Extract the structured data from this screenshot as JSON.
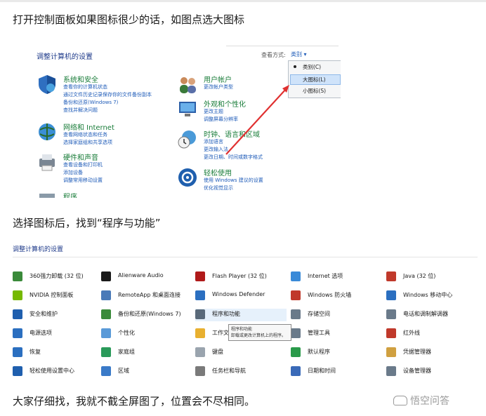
{
  "paragraphs": {
    "p1": "打开控制面板如果图标很少的话，如图点选大图标",
    "p2": "选择图标后，找到“程序与功能”",
    "p3": "大家仔细找，我就不截全屏图了，位置会不尽相同。"
  },
  "shot1": {
    "title": "调整计算机的设置",
    "view_by_label": "查看方式:",
    "view_by_value": "类别 ▾",
    "menu": [
      "类别(C)",
      "大图标(L)",
      "小图标(S)"
    ],
    "categories": [
      {
        "heading": "系统和安全",
        "links": [
          "查看你的计算机状态",
          "通过文件历史记录保存你的文件备份副本",
          "备份和还原(Windows 7)",
          "查找并解决问题"
        ]
      },
      {
        "heading": "网络和 Internet",
        "links": [
          "查看网络状态和任务",
          "选择家庭组和共享选项"
        ]
      },
      {
        "heading": "硬件和声音",
        "links": [
          "查看设备和打印机",
          "添加设备",
          "调整常用移动设置"
        ]
      },
      {
        "heading": "程序",
        "links": []
      },
      {
        "heading": "用户帐户",
        "links": [
          "更改帐户类型"
        ]
      },
      {
        "heading": "外观和个性化",
        "links": [
          "更改主题",
          "调整屏幕分辨率"
        ]
      },
      {
        "heading": "时钟、语言和区域",
        "links": [
          "添加语言",
          "更改输入法",
          "更改日期、时间或数字格式"
        ]
      },
      {
        "heading": "轻松使用",
        "links": [
          "使用 Windows 建议的设置",
          "优化视觉显示"
        ]
      }
    ]
  },
  "shot2": {
    "title": "调整计算机的设置",
    "columns": [
      [
        "360强力卸载 (32 位)",
        "NVIDIA 控制面板",
        "安全和维护",
        "电源选项",
        "恢复",
        "轻松使用设置中心"
      ],
      [
        "Alienware Audio",
        "RemoteApp 和桌面连接",
        "备份和还原(Windows 7)",
        "个性化",
        "家庭组",
        "区域"
      ],
      [
        "Flash Player (32 位)",
        "Windows Defender",
        "程序和功能",
        "工作文件夹",
        "键盘",
        "任务栏和导航"
      ],
      [
        "Internet 选项",
        "Windows 防火墙",
        "存储空间",
        "管理工具",
        "默认程序",
        "日期和时间"
      ],
      [
        "Java (32 位)",
        "Windows 移动中心",
        "电话和调制解调器",
        "红外线",
        "凭据管理器",
        "设备管理器"
      ]
    ],
    "tooltip": "卸载或更改计算机上的程序。",
    "tooltip_title": "程序和功能"
  },
  "watermark": "悟空问答",
  "colors": {
    "link": "#1e5bb8",
    "heading": "#1a7d3a",
    "arrow": "#e03030",
    "highlight": "#cfe3fa"
  }
}
